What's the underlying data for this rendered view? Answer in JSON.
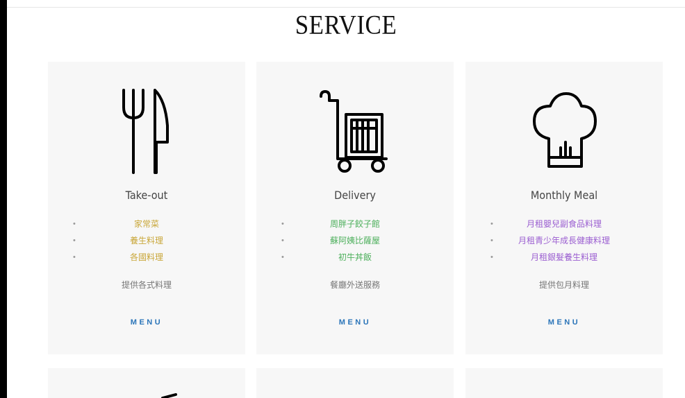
{
  "section": {
    "title": "SERVICE"
  },
  "cards": [
    {
      "icon": "fork-knife-icon",
      "title": "Take-out",
      "items": [
        "家常菜",
        "養生料理",
        "各國料理"
      ],
      "item_color": "#c9a73a",
      "description": "提供各式料理",
      "menu_label": "MENU"
    },
    {
      "icon": "delivery-cart-icon",
      "title": "Delivery",
      "items": [
        "周胖子餃子館",
        "蘇阿姨比薩屋",
        "初牛丼飯"
      ],
      "item_color": "#4caf5b",
      "description": "餐廳外送服務",
      "menu_label": "MENU"
    },
    {
      "icon": "chef-hat-icon",
      "title": "Monthly Meal",
      "items": [
        "月租嬰兒副食品料理",
        "月租青少年成長健康料理",
        "月租銀髮養生料理"
      ],
      "item_color": "#9b5fd1",
      "description": "提供包月料理",
      "menu_label": "MENU"
    }
  ],
  "bottom_cards": [
    {
      "icon": "partial-icon"
    },
    {
      "icon": ""
    },
    {
      "icon": ""
    }
  ]
}
